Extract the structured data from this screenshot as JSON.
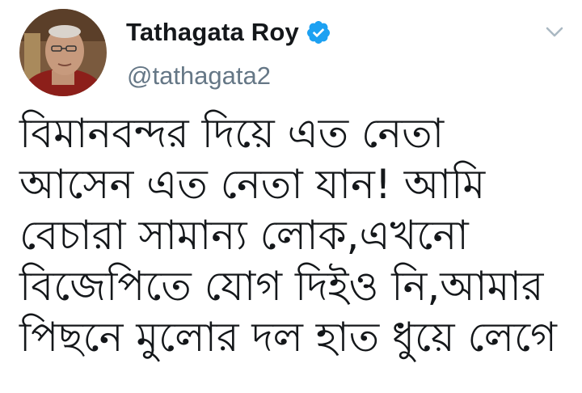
{
  "author": {
    "display_name": "Tathagata Roy",
    "handle": "@tathagata2",
    "verified": true,
    "avatar_icon": "profile-photo-avatar"
  },
  "tweet": {
    "text": "বিমানবন্দর দিয়ে এত নেতা\nআসেন এত নেতা যান! আমি\nবেচারা সামান্য লোক,এখনো\nবিজেপিতে যোগ দিইও নি,আমার\nপিছনে মুলোর দল হাত ধুয়ে লেগে"
  },
  "icons": {
    "verified": "verified-badge-icon",
    "menu": "chevron-down-icon"
  },
  "colors": {
    "text_primary": "#14171a",
    "text_secondary": "#657786",
    "verified_blue": "#1da1f2",
    "caret_gray": "#aab8c2"
  }
}
